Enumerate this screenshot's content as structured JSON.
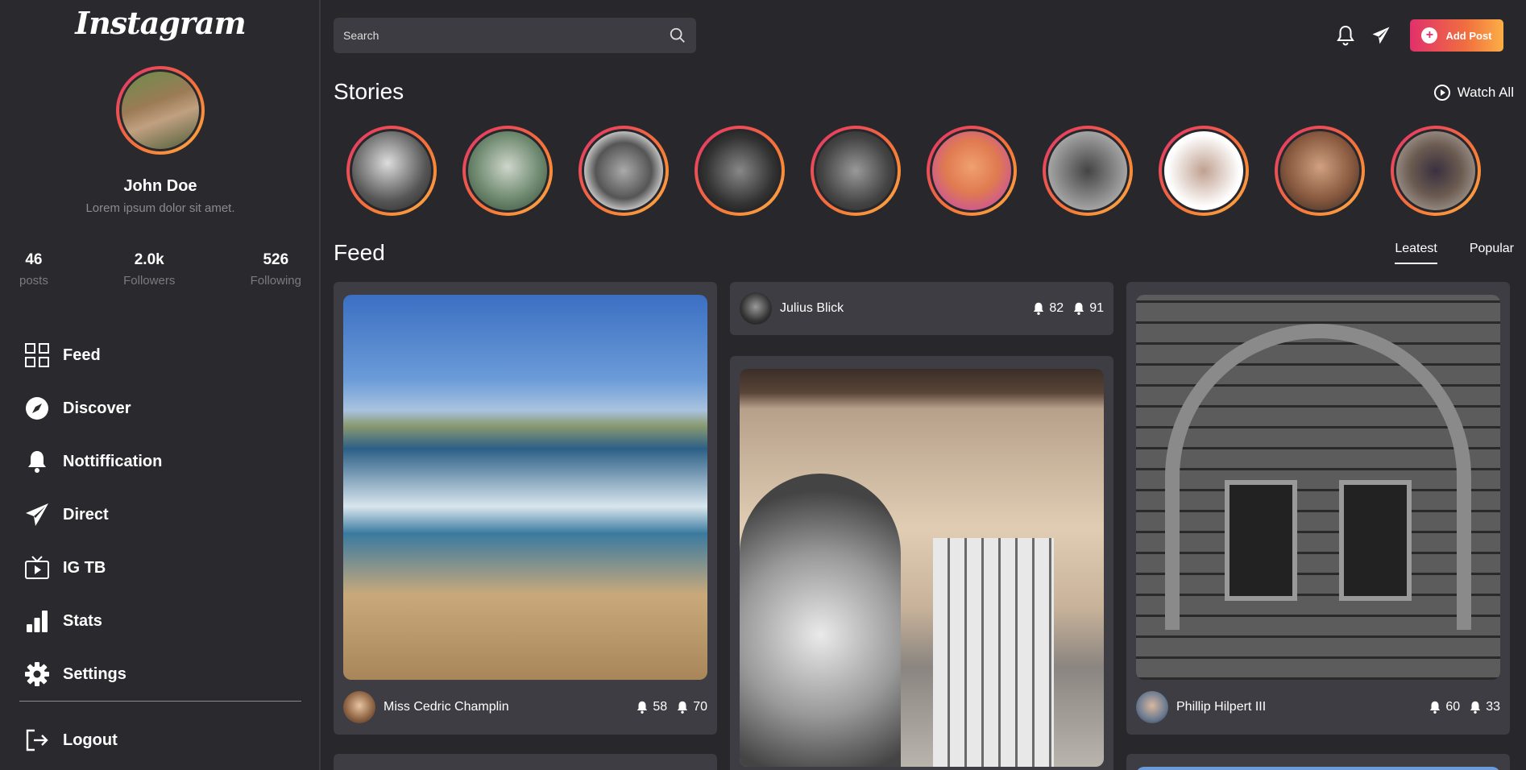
{
  "sidebar": {
    "logo": "Instagram",
    "profile": {
      "name": "John Doe",
      "bio": "Lorem ipsum dolor sit amet."
    },
    "stats": [
      {
        "value": "46",
        "label": "posts"
      },
      {
        "value": "2.0k",
        "label": "Followers"
      },
      {
        "value": "526",
        "label": "Following"
      }
    ],
    "nav": [
      {
        "label": "Feed",
        "icon": "grid-icon"
      },
      {
        "label": "Discover",
        "icon": "compass-icon"
      },
      {
        "label": "Nottiffication",
        "icon": "bell-icon"
      },
      {
        "label": "Direct",
        "icon": "paper-plane-icon"
      },
      {
        "label": "IG TB",
        "icon": "tv-icon"
      },
      {
        "label": "Stats",
        "icon": "bar-chart-icon"
      },
      {
        "label": "Settings",
        "icon": "gear-icon"
      }
    ],
    "logout": "Logout"
  },
  "header": {
    "search_placeholder": "Search",
    "add_post": "Add Post"
  },
  "stories": {
    "title": "Stories",
    "watch_all": "Watch All"
  },
  "feed": {
    "title": "Feed",
    "tabs": [
      "Leatest",
      "Popular"
    ],
    "cards": [
      {
        "author": "Miss Cedric Champlin",
        "likes": "58",
        "comments": "70"
      },
      {
        "author": "Julius Blick",
        "likes": "82",
        "comments": "91"
      },
      {
        "author": "Phillip Hilpert III",
        "likes": "60",
        "comments": "33"
      }
    ]
  },
  "colors": {
    "accent_start": "#e1306c",
    "accent_end": "#fcaf45",
    "background": "#28282c",
    "card": "#3d3d43"
  }
}
